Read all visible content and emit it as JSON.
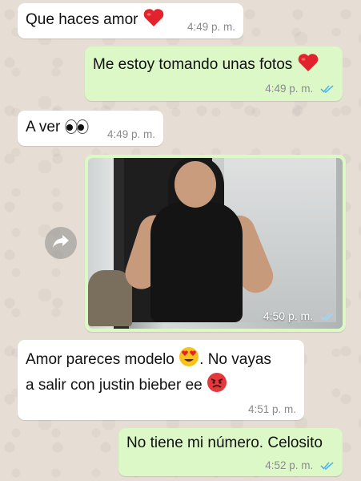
{
  "messages": [
    {
      "side": "in",
      "text": "Que haces amor",
      "time": "4:49 p. m."
    },
    {
      "side": "out",
      "text": "Me estoy tomando unas fotos",
      "time": "4:49 p. m."
    },
    {
      "side": "in",
      "text": "A ver",
      "time": "4:49 p. m."
    },
    {
      "side": "out",
      "type": "photo",
      "time": "4:50 p. m."
    },
    {
      "side": "in",
      "text_line1": "Amor pareces modelo",
      "text_line1b": ". No vayas",
      "text_line2": "a salir con justin bieber ee",
      "time": "4:51 p. m."
    },
    {
      "side": "out",
      "text": "No tiene mi número. Celosito",
      "time": "4:52 p. m."
    }
  ],
  "icons": {
    "heart": "red-heart-emoji",
    "eyes": "eyes-emoji",
    "heart_eyes": "heart-eyes-emoji",
    "angry": "angry-face-emoji",
    "read_ticks": "double-check-icon",
    "forward": "forward-arrow-icon"
  },
  "colors": {
    "incoming_bubble": "#ffffff",
    "outgoing_bubble": "#dcf8c6",
    "read_ticks": "#4fb6ec",
    "timestamp": "#8a8a8a"
  }
}
